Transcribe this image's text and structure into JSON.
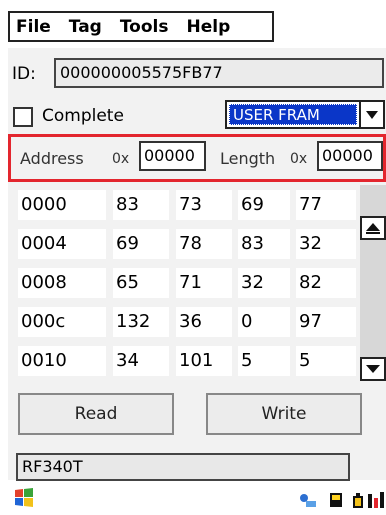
{
  "menu": {
    "items": [
      "File",
      "Tag",
      "Tools",
      "Help"
    ]
  },
  "id": {
    "label": "ID:",
    "value": "000000005575FB77"
  },
  "complete": {
    "label": "Complete",
    "checked": false
  },
  "memory_select": {
    "value": "USER FRAM"
  },
  "address": {
    "label": "Address",
    "prefix": "0x",
    "value": "00000"
  },
  "length": {
    "label": "Length",
    "prefix": "0x",
    "value": "00000"
  },
  "grid": {
    "rows": [
      {
        "addr": "0000",
        "bytes": [
          "83",
          "73",
          "69",
          "77"
        ]
      },
      {
        "addr": "0004",
        "bytes": [
          "69",
          "78",
          "83",
          "32"
        ]
      },
      {
        "addr": "0008",
        "bytes": [
          "65",
          "71",
          "32",
          "82"
        ]
      },
      {
        "addr": "000c",
        "bytes": [
          "132",
          "36",
          "0",
          "97"
        ]
      },
      {
        "addr": "0010",
        "bytes": [
          "34",
          "101",
          "5",
          "5"
        ]
      }
    ]
  },
  "buttons": {
    "read": "Read",
    "write": "Write"
  },
  "status": {
    "value": "RF340T"
  },
  "colors": {
    "highlight_border": "#e3262e",
    "selected_bg": "#0a36c8"
  },
  "taskbar": {
    "icons": [
      "windows-start-icon",
      "network-icon",
      "device-icon",
      "battery-icon",
      "signal-icon"
    ]
  }
}
